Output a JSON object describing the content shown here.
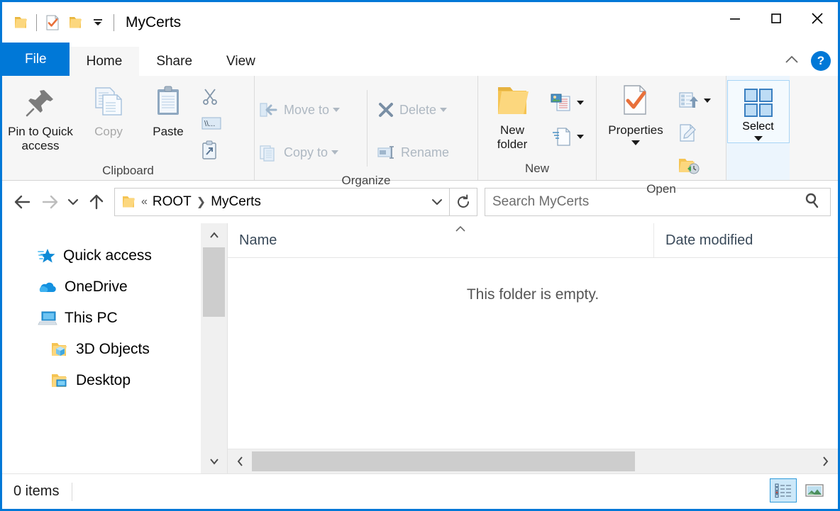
{
  "window": {
    "title": "MyCerts",
    "controls": {
      "minimize": "Minimize",
      "maximize": "Maximize",
      "close": "Close"
    }
  },
  "quick_access_toolbar": {
    "items": [
      {
        "name": "folder-icon",
        "label": "Explorer"
      },
      {
        "name": "properties-icon",
        "label": "Properties"
      },
      {
        "name": "new-folder-icon",
        "label": "New folder"
      },
      {
        "name": "chevron-down-icon",
        "label": "Customize Quick Access Toolbar"
      }
    ]
  },
  "ribbon": {
    "tabs": [
      {
        "label": "File",
        "active": false,
        "kind": "file"
      },
      {
        "label": "Home",
        "active": true,
        "kind": "normal"
      },
      {
        "label": "Share",
        "active": false,
        "kind": "normal"
      },
      {
        "label": "View",
        "active": false,
        "kind": "normal"
      }
    ],
    "collapse_label": "Minimize the Ribbon",
    "help_label": "?",
    "groups": [
      {
        "title": "Clipboard",
        "big_buttons": [
          {
            "label": "Pin to Quick access",
            "icon": "pin-icon",
            "disabled": false
          },
          {
            "label": "Copy",
            "icon": "copy-icon",
            "disabled": true
          },
          {
            "label": "Paste",
            "icon": "paste-icon",
            "disabled": false
          }
        ],
        "small_buttons": [
          {
            "label": "Cut",
            "icon": "scissors-icon"
          },
          {
            "label": "Copy path",
            "icon": "copy-path-icon"
          },
          {
            "label": "Paste shortcut",
            "icon": "paste-shortcut-icon"
          }
        ]
      },
      {
        "title": "Organize",
        "small_buttons": [
          {
            "label": "Move to",
            "icon": "move-to-icon",
            "disabled": true,
            "has_caret": true
          },
          {
            "label": "Copy to",
            "icon": "copy-to-icon",
            "disabled": true,
            "has_caret": true
          },
          {
            "label": "Delete",
            "icon": "delete-icon",
            "disabled": true,
            "has_caret": true
          },
          {
            "label": "Rename",
            "icon": "rename-icon",
            "disabled": true,
            "has_caret": false
          }
        ]
      },
      {
        "title": "New",
        "big_buttons": [
          {
            "label": "New folder",
            "icon": "new-folder-icon",
            "disabled": false
          }
        ],
        "small_buttons": [
          {
            "label": "New item",
            "icon": "new-item-icon",
            "has_caret": true
          },
          {
            "label": "Easy access",
            "icon": "easy-access-icon",
            "has_caret": true
          }
        ]
      },
      {
        "title": "Open",
        "big_buttons": [
          {
            "label": "Properties",
            "icon": "properties-icon",
            "disabled": false,
            "has_caret": true
          }
        ],
        "small_buttons": [
          {
            "label": "Open",
            "icon": "open-icon",
            "has_caret": true
          },
          {
            "label": "Edit",
            "icon": "edit-icon",
            "has_caret": false
          },
          {
            "label": "History",
            "icon": "history-icon",
            "has_caret": false
          }
        ]
      },
      {
        "title": "",
        "big_buttons": [
          {
            "label": "Select",
            "icon": "select-icon",
            "disabled": false,
            "has_caret": true
          }
        ]
      }
    ]
  },
  "address_bar": {
    "back_label": "Back",
    "forward_label": "Forward",
    "recent_label": "Recent locations",
    "up_label": "Up to ROOT",
    "breadcrumbs": [
      {
        "label": "«",
        "type": "overflow"
      },
      {
        "label": "ROOT",
        "type": "crumb"
      },
      {
        "label": "MyCerts",
        "type": "crumb"
      }
    ],
    "dropdown_label": "Previous locations",
    "refresh_label": "Refresh",
    "search": {
      "placeholder": "Search MyCerts",
      "value": "",
      "icon": "search-icon"
    }
  },
  "nav_pane": {
    "items": [
      {
        "label": "Quick access",
        "icon": "quick-access-star-icon",
        "indent": 0
      },
      {
        "label": "OneDrive",
        "icon": "onedrive-cloud-icon",
        "indent": 0
      },
      {
        "label": "This PC",
        "icon": "this-pc-icon",
        "indent": 0
      },
      {
        "label": "3D Objects",
        "icon": "3d-objects-folder-icon",
        "indent": 1
      },
      {
        "label": "Desktop",
        "icon": "desktop-folder-icon",
        "indent": 1
      }
    ],
    "scrollbar": {
      "up_label": "Scroll up",
      "down_label": "Scroll down"
    }
  },
  "file_list": {
    "columns": [
      {
        "label": "Name",
        "sorted": "asc"
      },
      {
        "label": "Date modified",
        "sorted": ""
      }
    ],
    "rows": [],
    "empty_message": "This folder is empty.",
    "hscroll": {
      "left_label": "Scroll left",
      "right_label": "Scroll right"
    }
  },
  "status_bar": {
    "item_count": "0 items",
    "views": [
      {
        "name": "details-view-button",
        "label": "Details view",
        "active": true
      },
      {
        "name": "large-icons-view-button",
        "label": "Large icons view",
        "active": false
      }
    ]
  },
  "colors": {
    "accent": "#0078d7",
    "ribbon_bg": "#f6f6f6",
    "select_group_bg": "#ecf5fd",
    "folder_yellow": "#ffd274",
    "check_orange": "#e8703a",
    "scroll_thumb": "#cdcdcd"
  }
}
